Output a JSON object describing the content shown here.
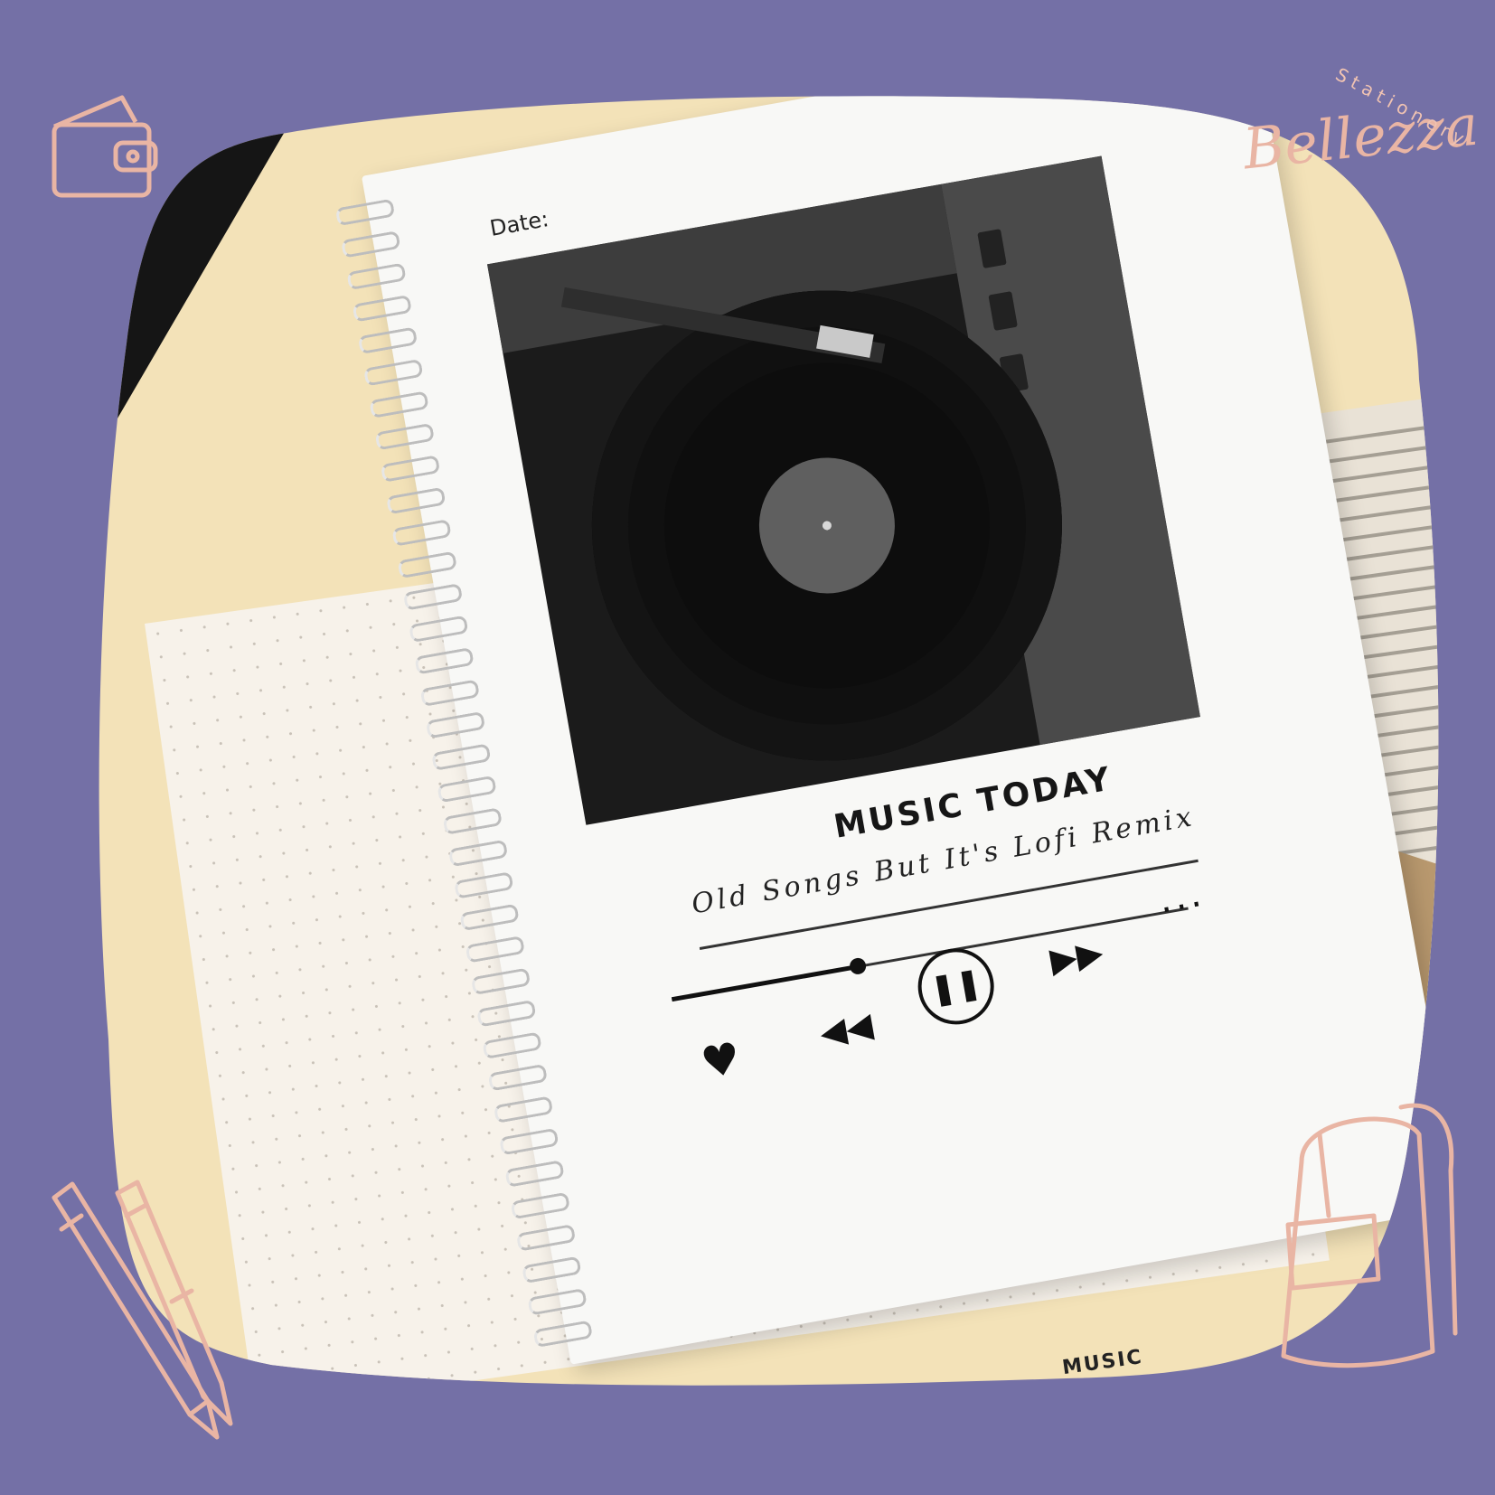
{
  "brand": {
    "name_script": "Bellezza",
    "name_arc": "Stationery"
  },
  "notebook": {
    "date_label": "Date:",
    "title": "MUSIC TODAY",
    "subtitle": "Old Songs But It's Lofi Remix",
    "more_label": "...",
    "progress": 0.36
  },
  "open_notebook": {
    "label": "MUSIC"
  },
  "colors": {
    "background": "#7470a6",
    "desk": "#f3e2b8",
    "doodle": "#e9b5a4"
  },
  "icons": [
    "wallet-icon",
    "pen-pencil-icon",
    "backpack-icon",
    "music-note-icon",
    "heart-icon",
    "rewind-icon",
    "pause-icon",
    "fast-forward-icon"
  ]
}
